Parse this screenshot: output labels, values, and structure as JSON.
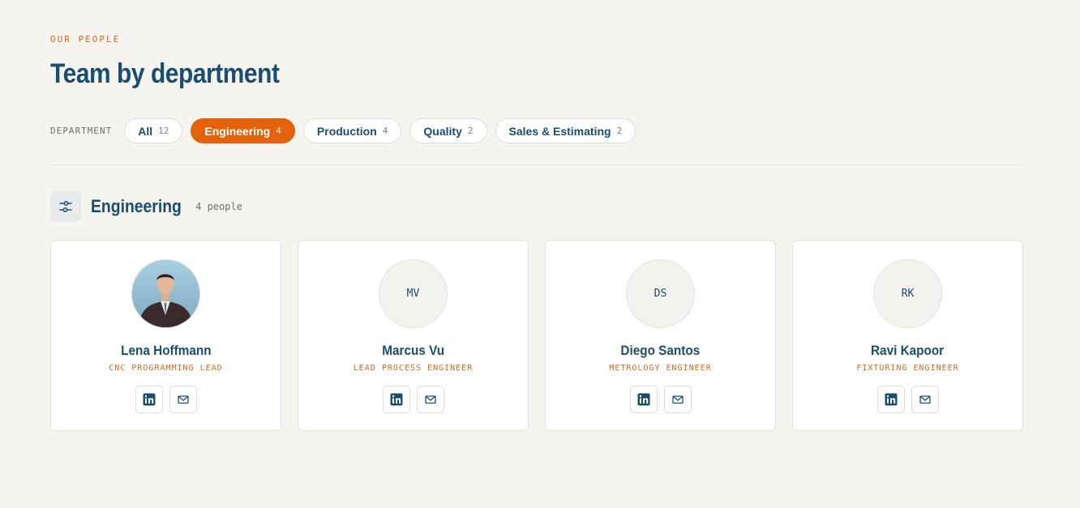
{
  "header": {
    "eyebrow": "OUR PEOPLE",
    "title": "Team by department"
  },
  "filters": {
    "label": "DEPARTMENT",
    "chips": [
      {
        "label": "All",
        "count": "12",
        "active": false
      },
      {
        "label": "Engineering",
        "count": "4",
        "active": true
      },
      {
        "label": "Production",
        "count": "4",
        "active": false
      },
      {
        "label": "Quality",
        "count": "2",
        "active": false
      },
      {
        "label": "Sales & Estimating",
        "count": "2",
        "active": false
      }
    ]
  },
  "section": {
    "title": "Engineering",
    "count": "4 people",
    "icon": "sliders-icon"
  },
  "people": [
    {
      "name": "Lena Hoffmann",
      "role": "CNC PROGRAMMING LEAD",
      "initials": "",
      "has_photo": true
    },
    {
      "name": "Marcus Vu",
      "role": "LEAD PROCESS ENGINEER",
      "initials": "MV",
      "has_photo": false
    },
    {
      "name": "Diego Santos",
      "role": "METROLOGY ENGINEER",
      "initials": "DS",
      "has_photo": false
    },
    {
      "name": "Ravi Kapoor",
      "role": "FIXTURING ENGINEER",
      "initials": "RK",
      "has_photo": false
    }
  ],
  "colors": {
    "accent": "#e5620d",
    "navy": "#1b4d70",
    "background": "#f5f4ef"
  }
}
